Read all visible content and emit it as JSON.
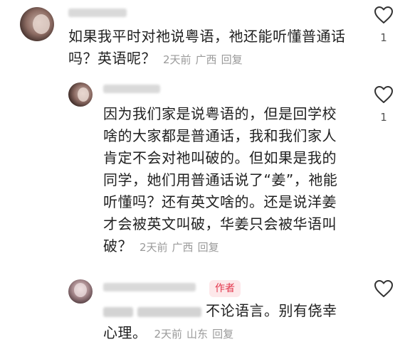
{
  "comments": [
    {
      "like_count": "1",
      "text_lines": [
        "如果我平时对祂说粤语，祂还能听懂普通话",
        "吗？英语呢？"
      ],
      "meta": {
        "time": "2天前",
        "location": "广西",
        "reply": "回复"
      }
    },
    {
      "like_count": "1",
      "text_lines": [
        "因为我们家是说粤语的，但是回学校",
        "啥的大家都是普通话，我和我们家人",
        "肯定不会对祂叫破的。但如果是我的",
        "同学，她们用普通话说了“姜”，祂能",
        "听懂吗？还有英文啥的。还是说洋姜",
        "才会被英文叫破，华姜只会被华语叫",
        "破？"
      ],
      "meta": {
        "time": "2天前",
        "location": "广西",
        "reply": "回复"
      }
    },
    {
      "author_tag": "作者",
      "text_lines": [
        "不论语言。别有侥幸",
        "心理。"
      ],
      "meta": {
        "time": "2天前",
        "location": "山东",
        "reply": "回复"
      }
    }
  ],
  "colors": {
    "author_tag_bg": "#fde8ea",
    "author_tag_text": "#e2364c",
    "meta_text": "#9a9a9a"
  }
}
